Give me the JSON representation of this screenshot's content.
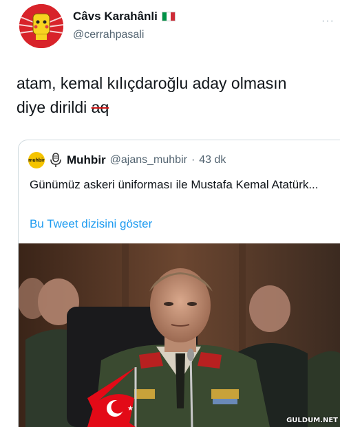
{
  "tweet": {
    "display_name": "Câvs Karahânli",
    "handle": "@cerrahpasali",
    "text_line1": "atam, kemal kılıçdaroğlu aday olmasın",
    "text_line2": "diye dirildi",
    "text_struck": "aq",
    "more_icon": "···"
  },
  "quoted": {
    "avatar_text": "muhbir",
    "name": "Muhbir",
    "handle": "@ajans_muhbir",
    "separator": "·",
    "time": "43 dk",
    "text": "Günümüz askeri üniforması ile Mustafa Kemal Atatürk...",
    "show_thread": "Bu Tweet dizisini göster"
  },
  "image": {
    "watermark": "GULDUM.NET"
  },
  "colors": {
    "link": "#1d9bf0",
    "secondary_text": "#536471",
    "avatar_red": "#d8232a",
    "muhbir_yellow": "#f5c400"
  }
}
